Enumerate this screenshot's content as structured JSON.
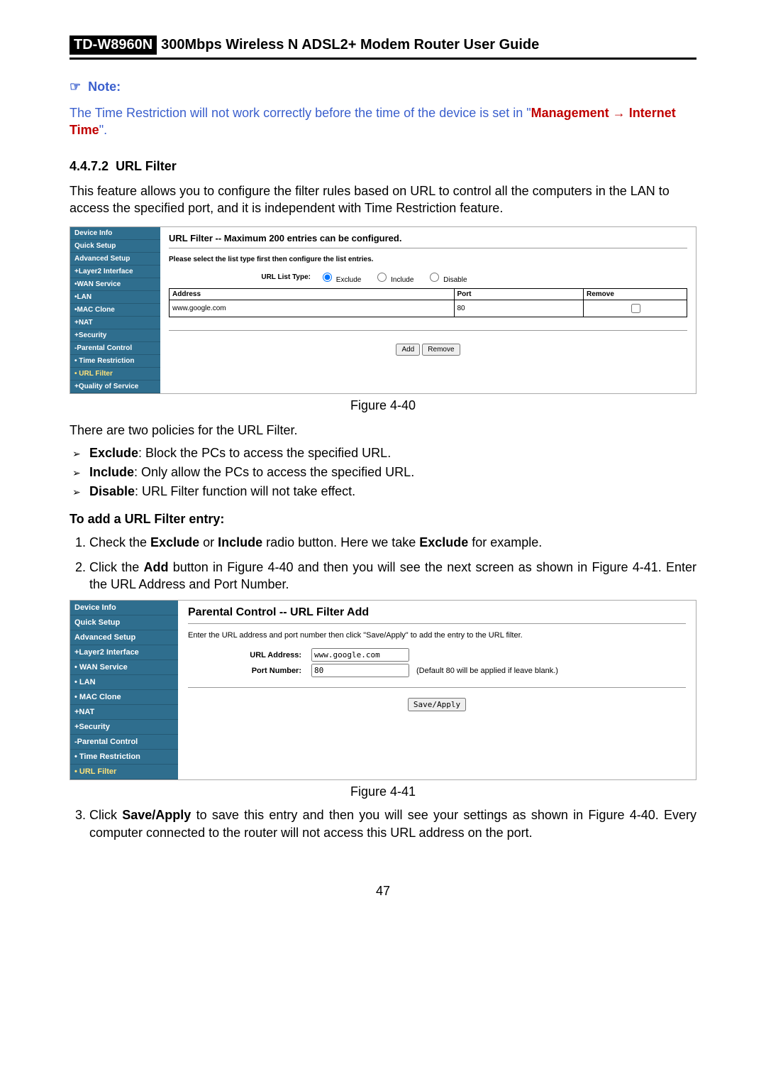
{
  "header": {
    "model": "TD-W8960N",
    "title": "300Mbps Wireless N ADSL2+ Modem Router User Guide"
  },
  "note": {
    "label": "Note:",
    "prefix": "The Time Restriction will not work correctly before the time of the device is set in \"",
    "mgmt": "Management",
    "arrow": " → ",
    "link": "Internet Time",
    "suffix": "\"."
  },
  "section": {
    "num": "4.4.7.2",
    "title": "URL Filter"
  },
  "intro": "This feature allows you to configure the filter rules based on URL to control all the computers in the LAN to access the specified port, and it is independent with Time Restriction feature.",
  "fig40": {
    "sidebar": [
      "Device Info",
      "Quick Setup",
      "Advanced Setup",
      "+Layer2 Interface",
      "•WAN Service",
      "•LAN",
      "•MAC Clone",
      "+NAT",
      "+Security",
      "-Parental Control",
      "• Time Restriction",
      "• URL Filter",
      "+Quality of Service"
    ],
    "active_idx": 11,
    "title": "URL Filter -- Maximum 200 entries can be configured.",
    "instruct": "Please select the list type first then configure the list entries.",
    "list_type_label": "URL List Type:",
    "radios": [
      "Exclude",
      "Include",
      "Disable"
    ],
    "cols": [
      "Address",
      "Port",
      "Remove"
    ],
    "row": {
      "address": "www.google.com",
      "port": "80"
    },
    "btn_add": "Add",
    "btn_remove": "Remove",
    "caption": "Figure 4-40"
  },
  "policies_intro": "There are two policies for the URL Filter.",
  "policies": [
    {
      "name": "Exclude",
      "desc": ": Block the PCs to access the specified URL."
    },
    {
      "name": "Include",
      "desc": ": Only allow the PCs to access the specified URL."
    },
    {
      "name": "Disable",
      "desc": ": URL Filter function will not take effect."
    }
  ],
  "add_head": "To add a URL Filter entry:",
  "steps": {
    "s1a": "Check the ",
    "s1b": "Exclude",
    "s1c": " or ",
    "s1d": "Include",
    "s1e": " radio button. Here we take ",
    "s1f": "Exclude",
    "s1g": " for example.",
    "s2a": "Click the ",
    "s2b": "Add",
    "s2c": " button in Figure 4-40 and then you will see the next screen as shown in Figure 4-41. Enter the URL Address and Port Number.",
    "s3a": "Click ",
    "s3b": "Save/Apply",
    "s3c": " to save this entry and then you will see your settings as shown in Figure 4-40. Every computer connected to the router will not access this URL address on the port."
  },
  "fig41": {
    "sidebar": [
      "Device Info",
      "Quick Setup",
      "Advanced Setup",
      "+Layer2 Interface",
      "• WAN Service",
      "• LAN",
      "• MAC Clone",
      "+NAT",
      "+Security",
      "-Parental Control",
      "• Time Restriction",
      "• URL Filter"
    ],
    "active_idx": 11,
    "title": "Parental Control -- URL Filter Add",
    "instruct": "Enter the URL address and port number then click \"Save/Apply\" to add the entry to the URL filter.",
    "url_label": "URL Address:",
    "url_value": "www.google.com",
    "port_label": "Port Number:",
    "port_value": "80",
    "port_hint": "(Default 80 will be applied if leave blank.)",
    "btn": "Save/Apply",
    "caption": "Figure 4-41"
  },
  "pagenum": "47"
}
